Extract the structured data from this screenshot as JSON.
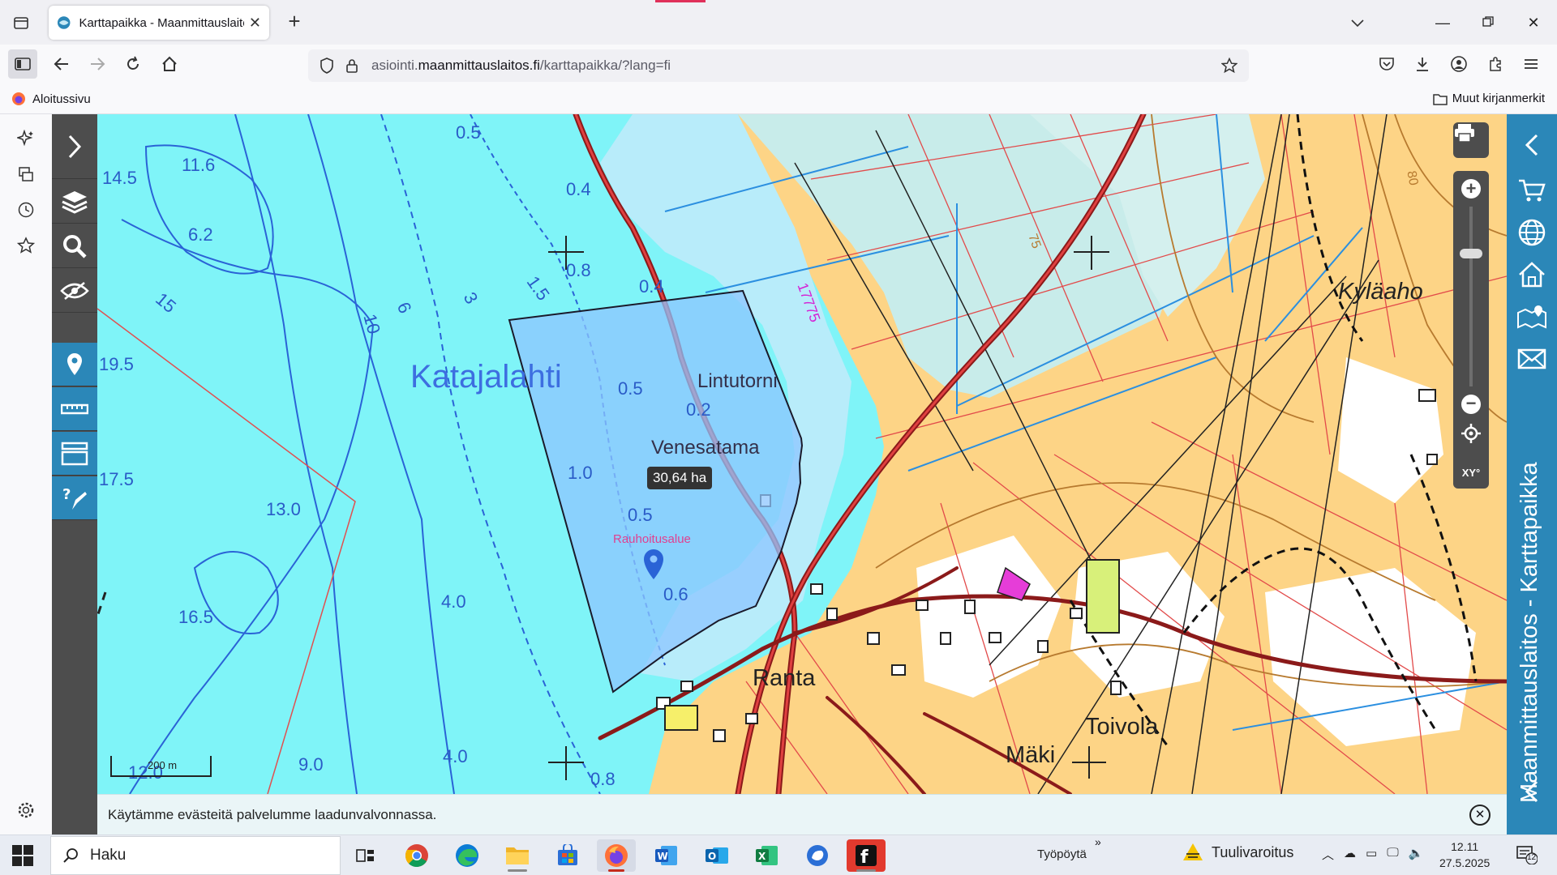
{
  "browser": {
    "tab_title": "Karttapaikka - Maanmittauslaitos",
    "url_host": "asiointi.",
    "url_domain": "maanmittauslaitos.fi",
    "url_path": "/karttapaikka/?lang=fi",
    "bookmark_home": "Aloitussivu",
    "bookmark_other": "Muut kirjanmerkit"
  },
  "map": {
    "area_measure": "30,64 ha",
    "scale_label": "200 m",
    "road_number": "17775",
    "contour_label_75": "75",
    "contour_label_80": "80",
    "places": {
      "bay": "Katajalahti",
      "tower": "Lintutorni",
      "harbor": "Venesatama",
      "protected": "Rauhoitusalue",
      "ranta": "Ranta",
      "toivola": "Toivola",
      "maki": "Mäki",
      "kylaaho": "Kyläaho"
    },
    "depths": {
      "d1": "14.5",
      "d2": "11.6",
      "d3": "6.2",
      "d4": "19.5",
      "d5": "17.5",
      "d6": "13.0",
      "d7": "16.5",
      "d8": "4.0",
      "d9": "9.0",
      "d10": "4.0",
      "d11": "12.0",
      "d12": "0.5",
      "d13": "0.4",
      "d14": "0.8",
      "d15": "0.4",
      "d16": "0.5",
      "d17": "0.2",
      "d18": "1.0",
      "d19": "0.5",
      "d20": "0.6",
      "d21": "0.8"
    },
    "contours": {
      "c15": "15",
      "c10": "10",
      "c6": "6",
      "c3": "3",
      "c15b": "1.5"
    }
  },
  "cookie_notice": "Käytämme evästeitä palvelumme laadunvalvonnassa.",
  "right_panel_title": "Maanmittauslaitos - Karttapaikka",
  "taskbar": {
    "search_placeholder": "Haku",
    "desktop_label": "Työpöytä",
    "weather": "Tuulivaroitus",
    "time": "12.11",
    "date": "27.5.2025",
    "notification_count": "12"
  },
  "colors": {
    "water": "#7ff4f8",
    "field": "#fdd486",
    "polygon": "#8ec6ff",
    "brand_blue": "#2b87b8",
    "tool_gray": "#4d4d4d"
  }
}
